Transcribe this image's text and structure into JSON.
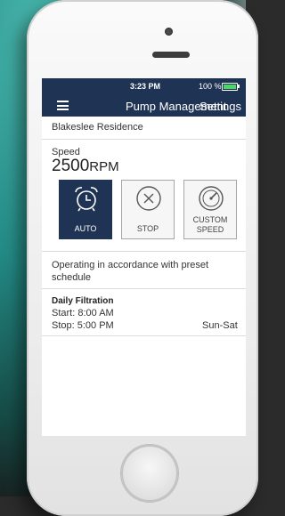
{
  "status_bar": {
    "time": "3:23 PM",
    "battery": "100 %"
  },
  "nav": {
    "title": "Pump Management",
    "settings": "Settings",
    "menu_icon": "hamburger-icon"
  },
  "residence": "Blakeslee Residence",
  "speed": {
    "label": "Speed",
    "value": "2500",
    "unit": "RPM"
  },
  "modes": [
    {
      "label": "AUTO",
      "icon": "alarm-clock-icon",
      "active": true
    },
    {
      "label": "STOP",
      "icon": "close-circle-icon",
      "active": false
    },
    {
      "label_line1": "CUSTOM",
      "label_line2": "SPEED",
      "icon": "gauge-icon",
      "active": false
    }
  ],
  "description": "Operating in accordance with preset schedule",
  "schedule": {
    "title": "Daily Filtration",
    "start": "Start: 8:00 AM",
    "stop": "Stop: 5:00 PM",
    "days": "Sun-Sat"
  },
  "colors": {
    "primary": "#1f3354",
    "battery": "#4bd764"
  }
}
